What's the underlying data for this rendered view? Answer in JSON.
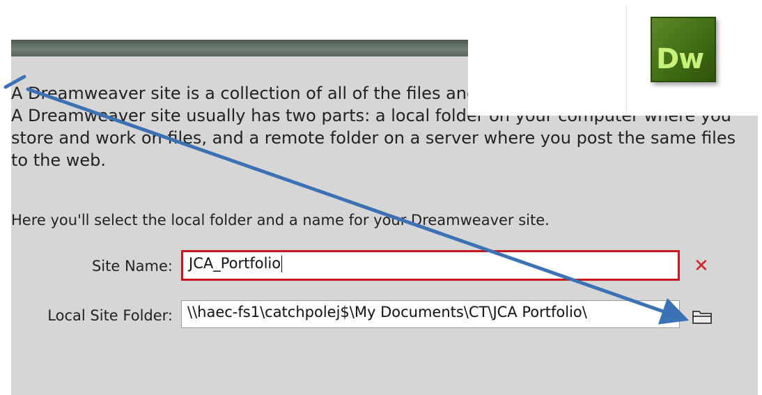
{
  "dialog": {
    "description": "A Dreamweaver site is a collection of all of the files and assets you use in your website. A Dreamweaver site usually has two parts: a local folder on your computer where you store and work on files, and a remote folder on a server where you post the same files to the web.",
    "instruction": "Here you'll select the local folder and a name for your Dreamweaver site.",
    "site_name_label": "Site Name:",
    "site_name_value": "JCA_Portfolio",
    "local_folder_label": "Local Site Folder:",
    "local_folder_value": "\\\\haec-fs1\\catchpolej$\\My Documents\\CT\\JCA Portfolio\\",
    "error_icon": "✕",
    "folder_icon": "folder-icon"
  },
  "logo": {
    "text": "Dw",
    "color": "#4a7a1a"
  },
  "annotation": {
    "arrow_color": "#3b72b5"
  },
  "colors": {
    "dialog_bg": "#d6d6d6",
    "error_border": "#c8161d",
    "titlebar": "#5f6d62"
  }
}
